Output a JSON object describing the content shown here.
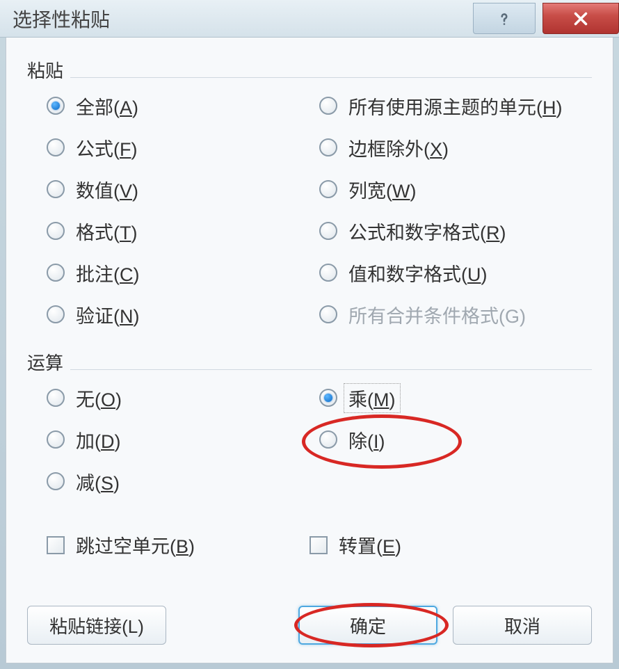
{
  "titlebar": {
    "title": "选择性粘贴"
  },
  "paste_group": {
    "label": "粘贴",
    "options": {
      "all": {
        "label": "全部",
        "accel": "A",
        "selected": true
      },
      "using_source": {
        "label": "所有使用源主题的单元",
        "accel": "H",
        "selected": false
      },
      "formulas": {
        "label": "公式",
        "accel": "F",
        "selected": false
      },
      "except_borders": {
        "label": "边框除外",
        "accel": "X",
        "selected": false
      },
      "values": {
        "label": "数值",
        "accel": "V",
        "selected": false
      },
      "col_widths": {
        "label": "列宽",
        "accel": "W",
        "selected": false
      },
      "formats": {
        "label": "格式",
        "accel": "T",
        "selected": false
      },
      "formula_num": {
        "label": "公式和数字格式",
        "accel": "R",
        "selected": false
      },
      "comments": {
        "label": "批注",
        "accel": "C",
        "selected": false
      },
      "value_num": {
        "label": "值和数字格式",
        "accel": "U",
        "selected": false
      },
      "validation": {
        "label": "验证",
        "accel": "N",
        "selected": false
      },
      "merge_cond": {
        "label": "所有合并条件格式",
        "accel": "G",
        "selected": false,
        "disabled": true
      }
    }
  },
  "operation_group": {
    "label": "运算",
    "options": {
      "none": {
        "label": "无",
        "accel": "O",
        "selected": false
      },
      "multiply": {
        "label": "乘",
        "accel": "M",
        "selected": true,
        "focused": true
      },
      "add": {
        "label": "加",
        "accel": "D",
        "selected": false
      },
      "divide": {
        "label": "除",
        "accel": "I",
        "selected": false
      },
      "subtract": {
        "label": "减",
        "accel": "S",
        "selected": false
      }
    }
  },
  "checkboxes": {
    "skip_blanks": {
      "label": "跳过空单元",
      "accel": "B",
      "checked": false
    },
    "transpose": {
      "label": "转置",
      "accel": "E",
      "checked": false
    }
  },
  "buttons": {
    "paste_link": {
      "label": "粘贴链接",
      "accel": "L"
    },
    "ok": {
      "label": "确定"
    },
    "cancel": {
      "label": "取消"
    }
  }
}
